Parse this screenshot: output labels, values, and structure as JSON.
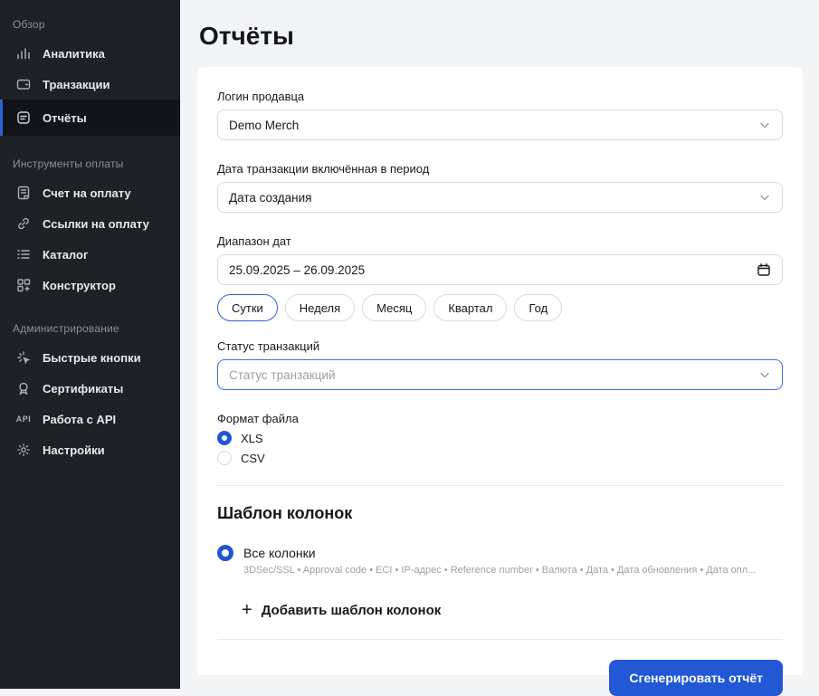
{
  "colors": {
    "accent": "#2257d6",
    "focus_border": "#3b6fdb",
    "sidebar_bg": "#1f2126",
    "active_item_bg": "#121419",
    "card_bg": "#ffffff",
    "page_bg": "#f3f4f6"
  },
  "page": {
    "title": "Отчёты"
  },
  "sidebar": {
    "sections": [
      {
        "header": "Обзор",
        "items": [
          {
            "label": "Аналитика",
            "icon": "bar-chart-icon",
            "active": false
          },
          {
            "label": "Транзакции",
            "icon": "wallet-icon",
            "active": false
          },
          {
            "label": "Отчёты",
            "icon": "report-icon",
            "active": true
          }
        ]
      },
      {
        "header": "Инструменты оплаты",
        "items": [
          {
            "label": "Счет на оплату",
            "icon": "invoice-icon",
            "active": false
          },
          {
            "label": "Ссылки на оплату",
            "icon": "link-icon",
            "active": false
          },
          {
            "label": "Каталог",
            "icon": "catalog-icon",
            "active": false
          },
          {
            "label": "Конструктор",
            "icon": "constructor-icon",
            "active": false
          }
        ]
      },
      {
        "header": "Администрирование",
        "items": [
          {
            "label": "Быстрые кнопки",
            "icon": "sparkle-icon",
            "active": false
          },
          {
            "label": "Сертификаты",
            "icon": "certificate-icon",
            "active": false
          },
          {
            "label": "Работа с API",
            "icon": "api-icon",
            "active": false
          },
          {
            "label": "Настройки",
            "icon": "gear-icon",
            "active": false
          }
        ]
      }
    ]
  },
  "form": {
    "merchant_login": {
      "label": "Логин продавца",
      "value": "Demo Merch"
    },
    "transaction_date": {
      "label": "Дата транзакции включённая в период",
      "value": "Дата создания"
    },
    "date_range": {
      "label": "Диапазон дат",
      "value": "25.09.2025 – 26.09.2025"
    },
    "period_pills": [
      {
        "label": "Сутки",
        "selected": true
      },
      {
        "label": "Неделя",
        "selected": false
      },
      {
        "label": "Месяц",
        "selected": false
      },
      {
        "label": "Квартал",
        "selected": false
      },
      {
        "label": "Год",
        "selected": false
      }
    ],
    "status": {
      "label": "Статус транзакций",
      "placeholder": "Статус транзакций"
    },
    "file_format": {
      "label": "Формат файла",
      "options": [
        {
          "label": "XLS",
          "selected": true
        },
        {
          "label": "CSV",
          "selected": false
        }
      ]
    },
    "columns_template": {
      "heading": "Шаблон колонок",
      "all_columns": {
        "label": "Все колонки",
        "selected": true,
        "description": "3DSec/SSL • Approval code • ECI • IP-адрес • Reference number • Валюта • Дата • Дата обновления • Дата опл..."
      },
      "add_label": "Добавить шаблон колонок"
    },
    "submit_label": "Сгенерировать отчёт"
  }
}
